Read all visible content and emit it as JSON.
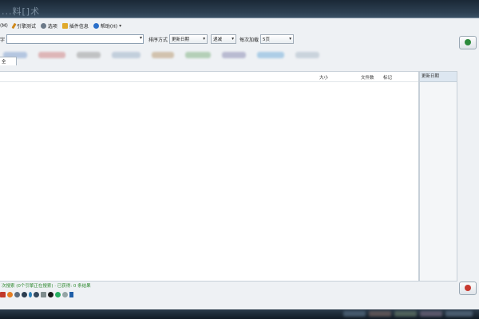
{
  "window": {
    "title": "...料[]术"
  },
  "menubar": {
    "items": [
      {
        "label": "(M)",
        "icon": "menu-icon",
        "color": "#4a6fa5"
      },
      {
        "label": "引擎测试",
        "icon": "brush-icon",
        "color": "#d08a1c"
      },
      {
        "label": "选项",
        "icon": "gear-icon",
        "color": "#6c7a89"
      },
      {
        "label": "插件信息",
        "icon": "folder-icon",
        "color": "#e0a92a"
      },
      {
        "label": "帮助(H)",
        "icon": "help-icon",
        "color": "#2a6fc9"
      }
    ]
  },
  "toolbar": {
    "search_label": "字",
    "search_value": "",
    "sort_label": "排序方式",
    "sort_value": "更新日期",
    "order_value": "递减",
    "per_page_label": "每次加载",
    "per_page_value": "5页"
  },
  "tab": {
    "label": "全"
  },
  "list": {
    "columns": [
      "大小",
      "文件数",
      "标记"
    ]
  },
  "sidepanel": {
    "header": "更新日期"
  },
  "statusbar": {
    "text": "次搜索 (0个引擎正在搜索) · 已获得: 0 条结果"
  },
  "colors": {
    "accent_green": "#2c8a3c",
    "accent_red": "#c8392f",
    "status_green": "#2f8a2f"
  }
}
